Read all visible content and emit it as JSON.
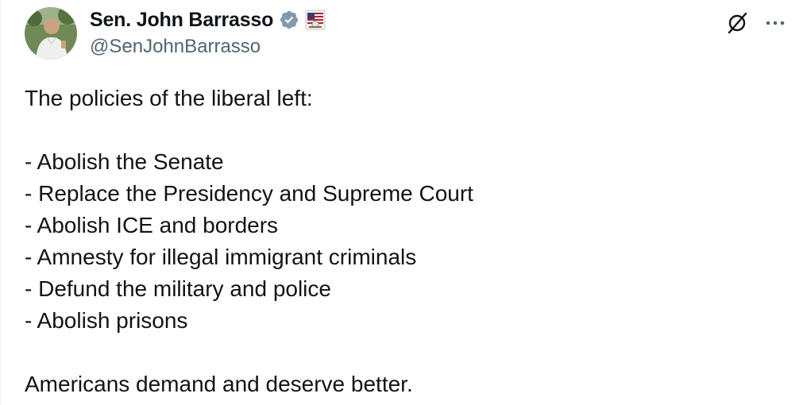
{
  "author": {
    "display_name": "Sen. John Barrasso",
    "handle": "@SenJohnBarrasso",
    "avatar_icon": "profile-photo",
    "verified_icon": "verified-badge-icon",
    "verified_color": "#829aab",
    "affiliation_icon": "us-capitol-flag-icon"
  },
  "header_actions": {
    "grok_icon": "grok-icon",
    "more_icon": "more-options-icon"
  },
  "tweet": {
    "intro": "The policies of the liberal left:",
    "list": [
      "- Abolish the Senate",
      "- Replace the Presidency and Supreme Court",
      "- Abolish ICE and borders",
      "- Amnesty for illegal immigrant criminals",
      "- Defund the military and police",
      "- Abolish prisons"
    ],
    "closing": "Americans demand and deserve better."
  },
  "colors": {
    "text": "#0f1419",
    "secondary_text": "#536471",
    "background": "#ffffff"
  }
}
